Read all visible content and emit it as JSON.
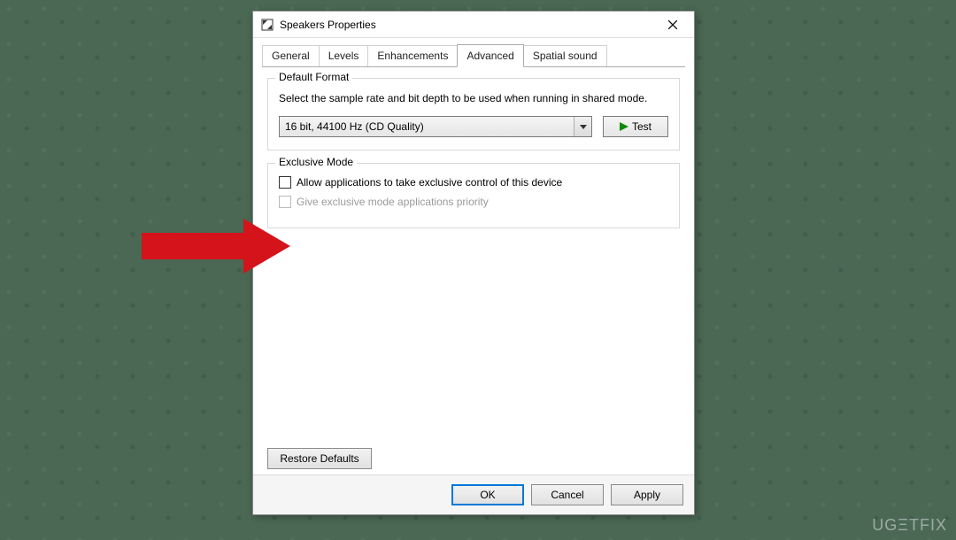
{
  "window": {
    "title": "Speakers Properties"
  },
  "tabs": {
    "general": "General",
    "levels": "Levels",
    "enhancements": "Enhancements",
    "advanced": "Advanced",
    "spatial": "Spatial sound",
    "active": "Advanced"
  },
  "default_format": {
    "legend": "Default Format",
    "description": "Select the sample rate and bit depth to be used when running in shared mode.",
    "selected": "16 bit, 44100 Hz (CD Quality)",
    "test_label": "Test"
  },
  "exclusive_mode": {
    "legend": "Exclusive Mode",
    "allow_label": "Allow applications to take exclusive control of this device",
    "allow_checked": false,
    "priority_label": "Give exclusive mode applications priority",
    "priority_checked": false,
    "priority_enabled": false
  },
  "buttons": {
    "restore": "Restore Defaults",
    "ok": "OK",
    "cancel": "Cancel",
    "apply": "Apply"
  },
  "watermark": "UGΞTFIX",
  "annotation": {
    "arrow_color": "#d5131a"
  }
}
